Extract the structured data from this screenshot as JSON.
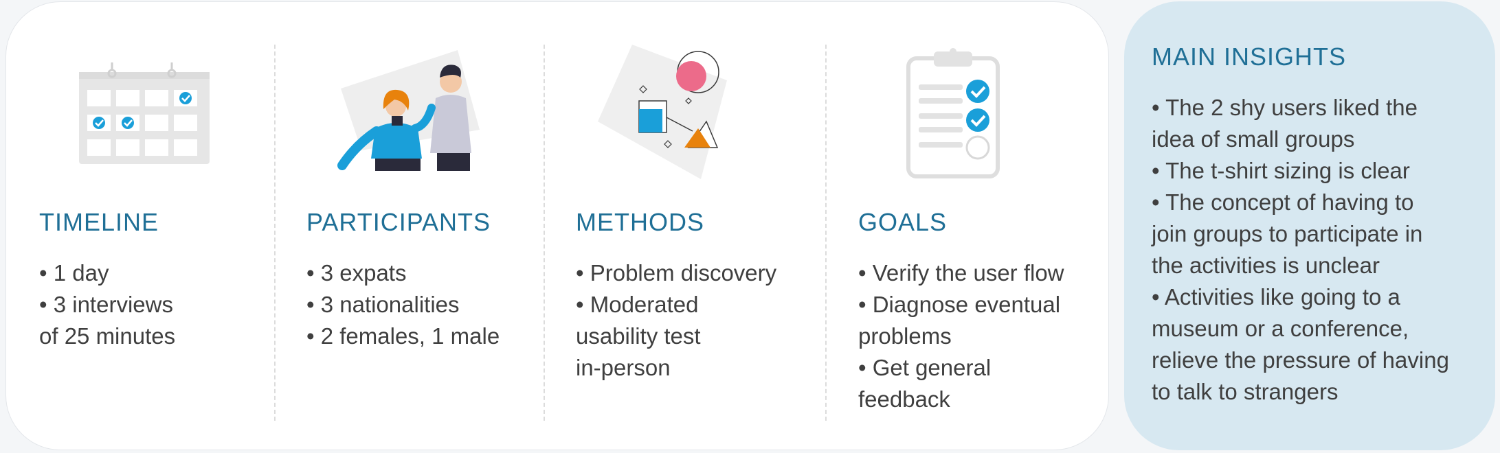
{
  "columns": [
    {
      "id": "timeline",
      "title": "TIMELINE",
      "icon": "calendar-icon",
      "lines": [
        "• 1 day",
        "• 3 interviews",
        "of 25 minutes"
      ]
    },
    {
      "id": "participants",
      "title": "PARTICIPANTS",
      "icon": "people-illustration",
      "lines": [
        "• 3 expats",
        "• 3 nationalities",
        "• 2 females, 1 male"
      ]
    },
    {
      "id": "methods",
      "title": "METHODS",
      "icon": "shapes-illustration",
      "lines": [
        "• Problem discovery",
        "• Moderated",
        "usability test",
        "in-person"
      ]
    },
    {
      "id": "goals",
      "title": "GOALS",
      "icon": "clipboard-checklist-icon",
      "lines": [
        "• Verify the user flow",
        "• Diagnose eventual",
        "problems",
        "• Get general",
        "feedback"
      ]
    }
  ],
  "insights": {
    "title": "MAIN INSIGHTS",
    "lines": [
      "• The 2 shy users liked the",
      "idea of small groups",
      "• The t-shirt sizing is clear",
      "• The concept of having to",
      "join groups to participate in",
      "the activities is unclear",
      "• Activities like going to a",
      "museum or a conference,",
      "relieve the pressure of having",
      "to talk to strangers"
    ]
  },
  "colors": {
    "accent": "#1f6f96",
    "check": "#1a9fd9",
    "orange": "#e8820c",
    "pink": "#ec6b8a",
    "text": "#3f3f3f",
    "insights_bg": "#d7e8f1"
  }
}
